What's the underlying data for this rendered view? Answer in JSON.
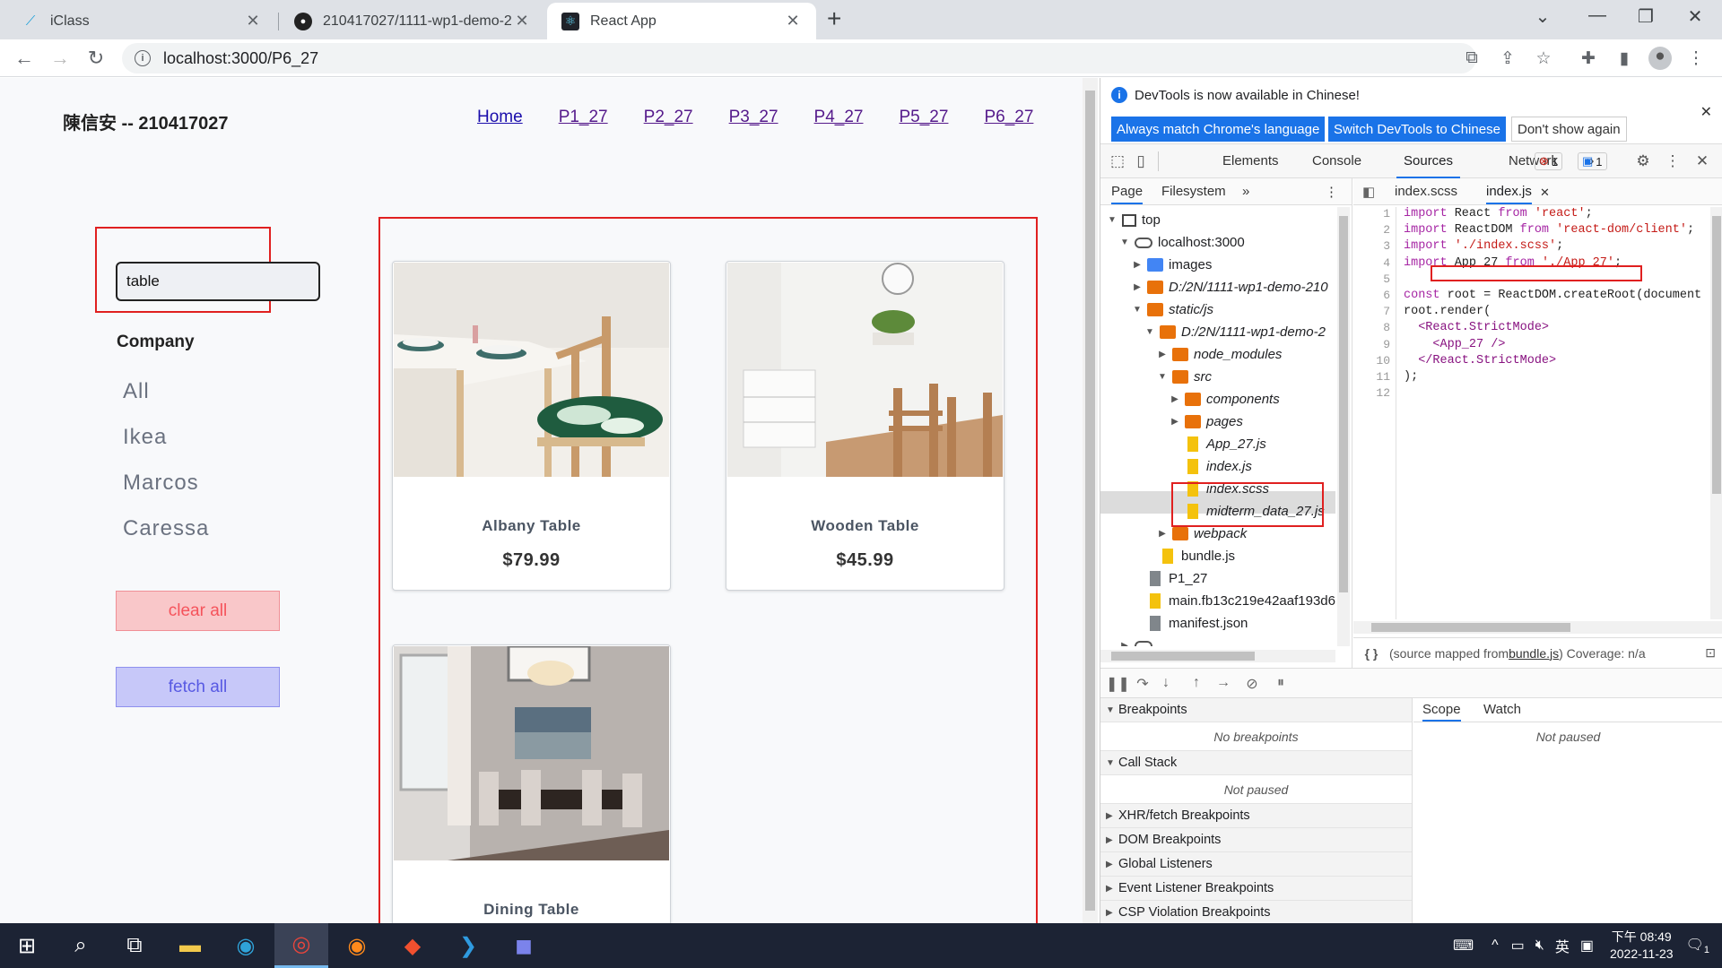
{
  "browser": {
    "tabs": [
      {
        "title": "iClass",
        "favicon": "iclass-icon"
      },
      {
        "title": "210417027/1111-wp1-demo-2",
        "favicon": "github-icon"
      },
      {
        "title": "React App",
        "favicon": "react-icon"
      }
    ],
    "url": "localhost:3000/P6_27"
  },
  "page": {
    "brand": "陳信安 -- 210417027",
    "nav": [
      "Home",
      "P1_27",
      "P2_27",
      "P3_27",
      "P4_27",
      "P5_27",
      "P6_27"
    ],
    "search_value": "table",
    "company_heading": "Company",
    "companies": [
      "All",
      "Ikea",
      "Marcos",
      "Caressa"
    ],
    "clear_label": "clear all",
    "fetch_label": "fetch all",
    "products": [
      {
        "name": "Albany Table",
        "price": "$79.99"
      },
      {
        "name": "Wooden Table",
        "price": "$45.99"
      },
      {
        "name": "Dining Table",
        "price": ""
      }
    ]
  },
  "devtools": {
    "banner_msg": "DevTools is now available in Chinese!",
    "banner_btn1": "Always match Chrome's language",
    "banner_btn2": "Switch DevTools to Chinese",
    "banner_btn3": "Don't show again",
    "tabs": [
      "Elements",
      "Console",
      "Sources",
      "Network"
    ],
    "error_count": "1",
    "message_count": "1",
    "nav_tabs": [
      "Page",
      "Filesystem"
    ],
    "tree": [
      "top",
      "localhost:3000",
      "images",
      "D:/2N/1111-wp1-demo-210",
      "static/js",
      "D:/2N/1111-wp1-demo-2",
      "node_modules",
      "src",
      "components",
      "pages",
      "App_27.js",
      "index.js",
      "index.scss",
      "midterm_data_27.js",
      "webpack",
      "bundle.js",
      "P1_27",
      "main.fb13c219e42aaf193d6",
      "manifest.json",
      "."
    ],
    "editor_tabs": [
      "index.scss",
      "index.js"
    ],
    "line_numbers": [
      "1",
      "2",
      "3",
      "4",
      "5",
      "6",
      "7",
      "8",
      "9",
      "10",
      "11",
      "12"
    ],
    "status_prefix": "(source mapped from ",
    "status_link": "bundle.js",
    "status_suffix": ") Coverage: n/a",
    "sections": [
      {
        "label": "Breakpoints",
        "open": true,
        "body": "No breakpoints"
      },
      {
        "label": "Call Stack",
        "open": true,
        "body": "Not paused"
      },
      {
        "label": "XHR/fetch Breakpoints",
        "open": false
      },
      {
        "label": "DOM Breakpoints",
        "open": false
      },
      {
        "label": "Global Listeners",
        "open": false
      },
      {
        "label": "Event Listener Breakpoints",
        "open": false
      },
      {
        "label": "CSP Violation Breakpoints",
        "open": false
      }
    ],
    "scope_tabs": [
      "Scope",
      "Watch"
    ],
    "scope_body": "Not paused"
  },
  "taskbar": {
    "ime": "英",
    "time": "下午 08:49",
    "date": "2022-11-23",
    "notif_count": "1"
  }
}
